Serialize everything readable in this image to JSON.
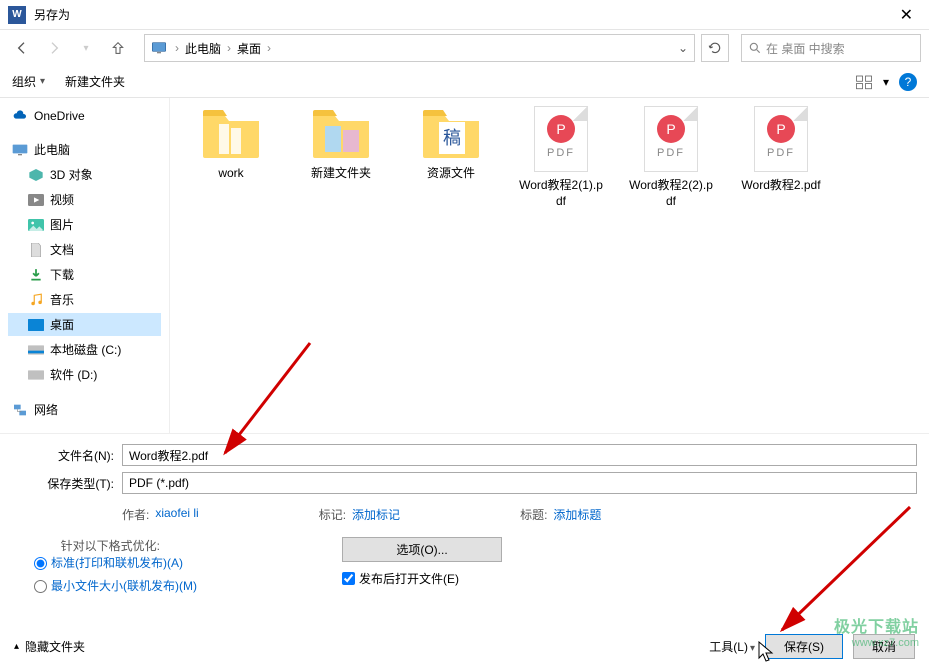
{
  "title": "另存为",
  "breadcrumb": {
    "root": "此电脑",
    "folder": "桌面"
  },
  "search": {
    "placeholder": "在 桌面 中搜索"
  },
  "toolbar": {
    "organize": "组织",
    "new_folder": "新建文件夹"
  },
  "tree": {
    "onedrive": "OneDrive",
    "thispc": "此电脑",
    "objects3d": "3D 对象",
    "videos": "视频",
    "pictures": "图片",
    "documents": "文档",
    "downloads": "下载",
    "music": "音乐",
    "desktop": "桌面",
    "localc": "本地磁盘 (C:)",
    "locald": "软件 (D:)",
    "network": "网络"
  },
  "files": [
    {
      "name": "work",
      "type": "folder",
      "variant": "docs"
    },
    {
      "name": "新建文件夹",
      "type": "folder",
      "variant": "images"
    },
    {
      "name": "资源文件",
      "type": "folder",
      "variant": "gao"
    },
    {
      "name": "Word教程2(1).pdf",
      "type": "pdf"
    },
    {
      "name": "Word教程2(2).pdf",
      "type": "pdf"
    },
    {
      "name": "Word教程2.pdf",
      "type": "pdf"
    }
  ],
  "form": {
    "filename_label": "文件名(N):",
    "filename_value": "Word教程2.pdf",
    "type_label": "保存类型(T):",
    "type_value": "PDF (*.pdf)",
    "author_label": "作者:",
    "author_value": "xiaofei li",
    "tag_label": "标记:",
    "tag_value": "添加标记",
    "title_label": "标题:",
    "title_value": "添加标题",
    "optimize_label": "针对以下格式优化:",
    "opt_standard": "标准(打印和联机发布)(A)",
    "opt_min": "最小文件大小(联机发布)(M)",
    "options_btn": "选项(O)...",
    "open_after": "发布后打开文件(E)"
  },
  "footer": {
    "hide_folders": "隐藏文件夹",
    "tools": "工具(L)",
    "save": "保存(S)",
    "cancel": "取消"
  },
  "watermark": {
    "line1": "极光下载站",
    "line2": "www.xz7.com"
  }
}
